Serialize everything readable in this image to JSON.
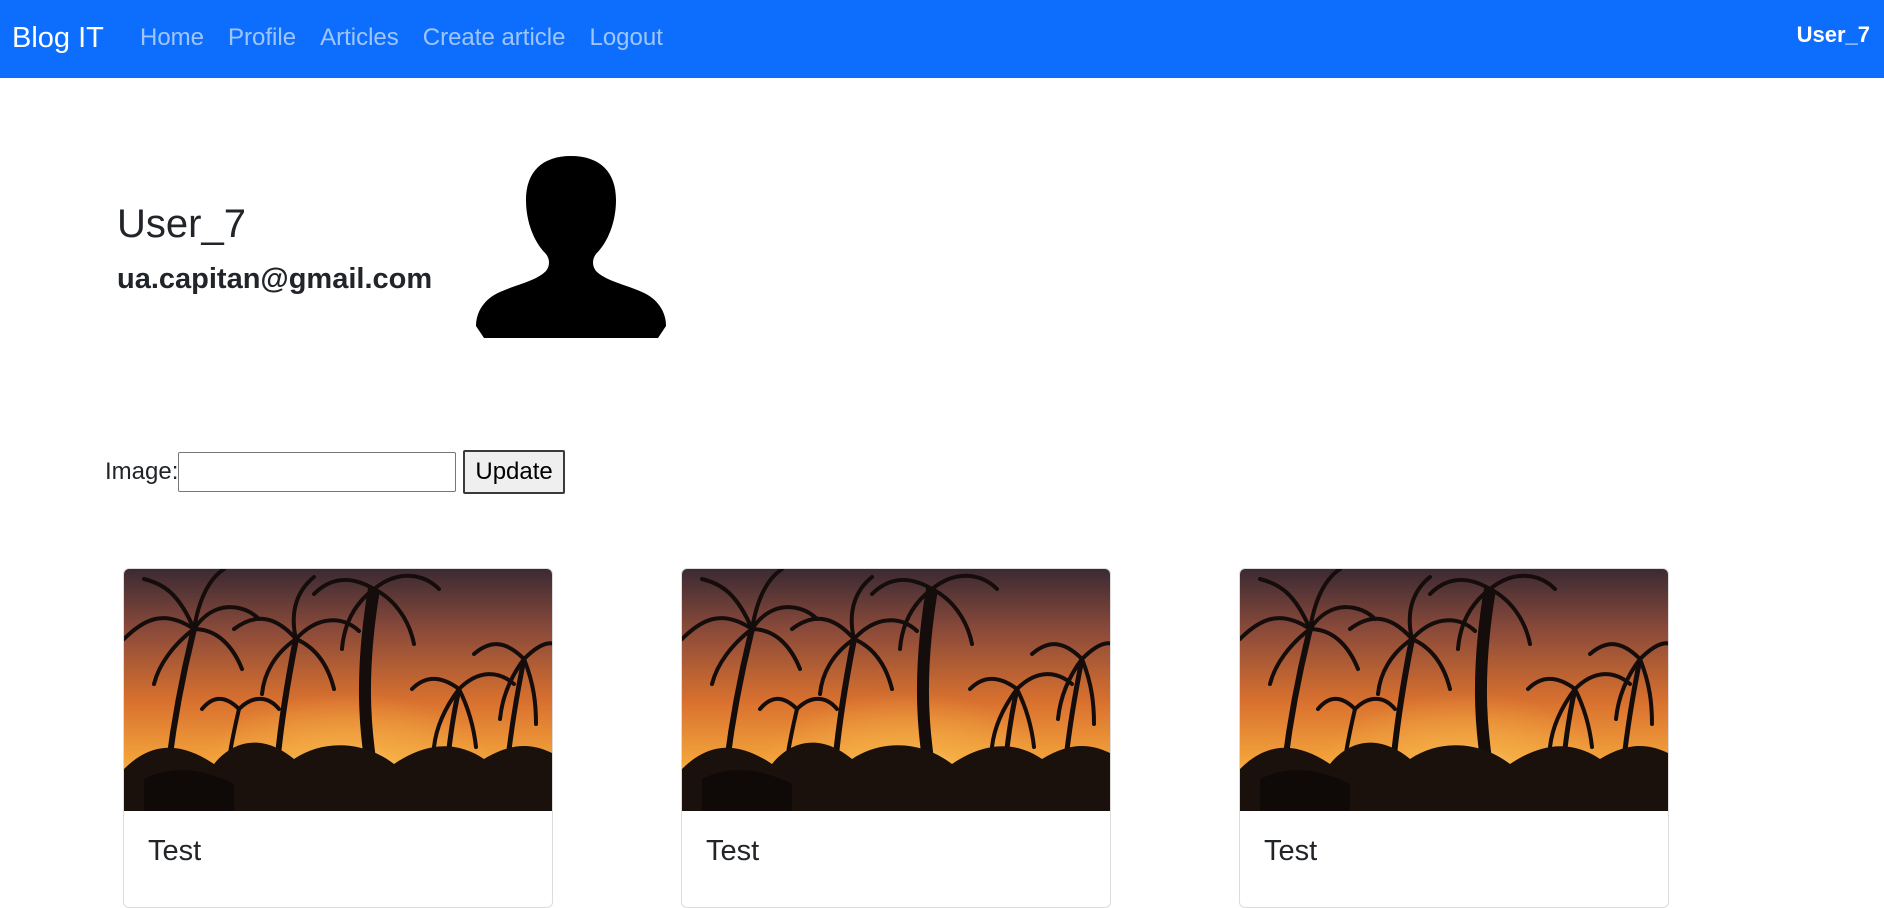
{
  "navbar": {
    "brand": "Blog IT",
    "links": [
      "Home",
      "Profile",
      "Articles",
      "Create article",
      "Logout"
    ],
    "user": "User_7",
    "bg_color": "#0d6efd"
  },
  "profile": {
    "name": "User_7",
    "email": "ua.capitan@gmail.com",
    "avatar_icon": "person-silhouette-icon"
  },
  "image_form": {
    "label": "Image:",
    "input_value": "",
    "button_label": "Update"
  },
  "articles": [
    {
      "title": "Test",
      "image": "sunset-palm-trees"
    },
    {
      "title": "Test",
      "image": "sunset-palm-trees"
    },
    {
      "title": "Test",
      "image": "sunset-palm-trees"
    }
  ]
}
